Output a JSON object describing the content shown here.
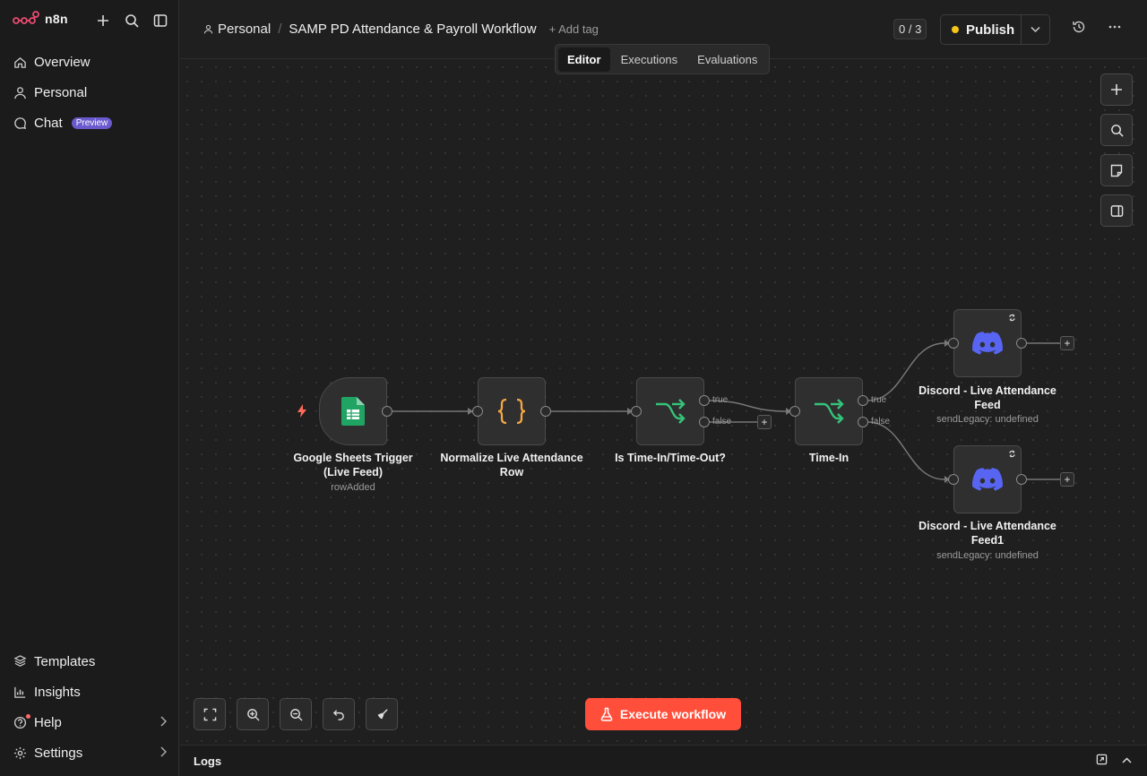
{
  "brand": {
    "name": "n8n"
  },
  "sidebar": {
    "top_items": [
      {
        "label": "Overview",
        "icon": "home-icon"
      },
      {
        "label": "Personal",
        "icon": "user-icon"
      },
      {
        "label": "Chat",
        "icon": "chat-icon",
        "badge": "Preview"
      }
    ],
    "bottom_items": [
      {
        "label": "Templates",
        "icon": "box-icon"
      },
      {
        "label": "Insights",
        "icon": "chart-icon"
      },
      {
        "label": "Help",
        "icon": "help-icon"
      },
      {
        "label": "Settings",
        "icon": "gear-icon"
      }
    ]
  },
  "header": {
    "breadcrumb_personal": "Personal",
    "separator": "/",
    "workflow_title": "SAMP PD Attendance & Payroll Workflow",
    "add_tag": "+ Add tag",
    "counter": "0 / 3",
    "publish_label": "Publish",
    "tabs": [
      "Editor",
      "Executions",
      "Evaluations"
    ],
    "active_tab": "Editor"
  },
  "nodes": [
    {
      "id": "trigger",
      "label": "Google Sheets Trigger (Live Feed)",
      "sub": "rowAdded",
      "icon": "google-sheets-icon"
    },
    {
      "id": "normalize",
      "label": "Normalize Live Attendance Row",
      "sub": "",
      "icon": "code-braces-icon"
    },
    {
      "id": "if1",
      "label": "Is Time-In/Time-Out?",
      "sub": "",
      "icon": "if-branch-icon",
      "true_label": "true",
      "false_label": "false"
    },
    {
      "id": "if2",
      "label": "Time-In",
      "sub": "",
      "icon": "if-branch-icon",
      "true_label": "true",
      "false_label": "false"
    },
    {
      "id": "discord1",
      "label": "Discord - Live Attendance Feed",
      "sub": "sendLegacy: undefined",
      "icon": "discord-icon"
    },
    {
      "id": "discord2",
      "label": "Discord - Live Attendance Feed1",
      "sub": "sendLegacy: undefined",
      "icon": "discord-icon"
    }
  ],
  "canvas": {
    "execute_label": "Execute workflow"
  },
  "logs": {
    "title": "Logs"
  },
  "colors": {
    "accent": "#ff4e3a",
    "sheets_green": "#1fa463",
    "code_orange": "#f5a742",
    "if_green": "#35c37a",
    "discord": "#5865f2",
    "publish_dot": "#f5c518"
  }
}
